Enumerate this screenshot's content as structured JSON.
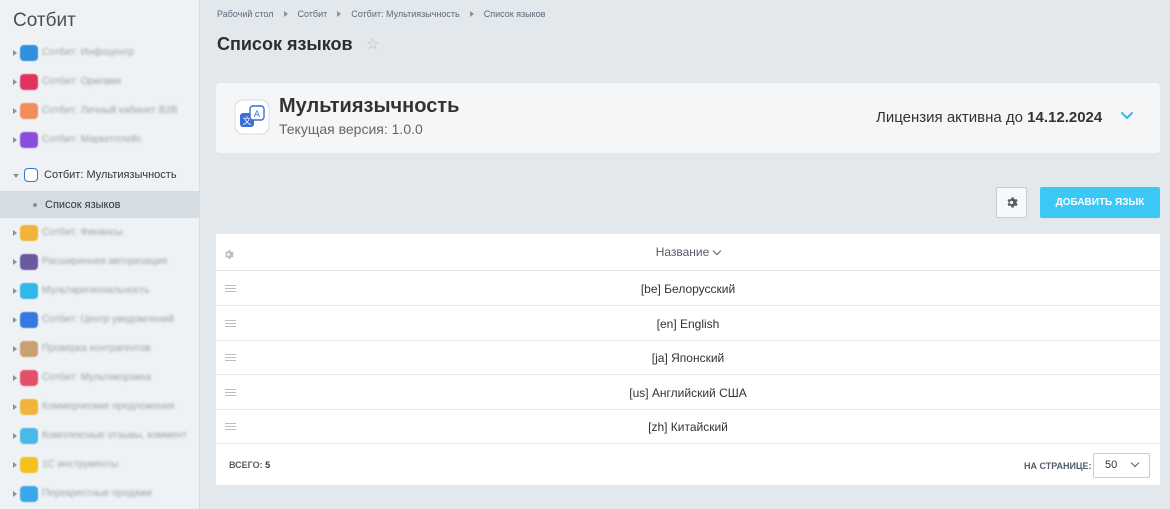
{
  "sidebar": {
    "title": "Сотбит",
    "items": [
      {
        "label": "Сотбит: Инфоцентр",
        "icon": "infocenter-icon",
        "color": "#2f8fe0"
      },
      {
        "label": "Сотбит: Оригами",
        "icon": "origami-icon",
        "color": "#e0345c"
      },
      {
        "label": "Сотбит: Личный кабинет B2B",
        "icon": "b2b-cabinet-icon",
        "color": "#f28c5a"
      },
      {
        "label": "Сотбит: Маркетплейс",
        "icon": "marketplace-icon",
        "color": "#8a4fd8"
      },
      {
        "label": "Сотбит: Мультиязычность",
        "icon": "translate-icon",
        "color": "#3a6fd8",
        "active": true
      },
      {
        "label": "Сотбит: Финансы",
        "icon": "finance-icon",
        "color": "#f0b43a"
      },
      {
        "label": "Расширенная авторизация",
        "icon": "auth-icon",
        "color": "#6a5a9e"
      },
      {
        "label": "Мультирегиональность",
        "icon": "multiregion-icon",
        "color": "#2fb8e8"
      },
      {
        "label": "Сотбит: Центр уведомлений",
        "icon": "notification-icon",
        "color": "#3478e0"
      },
      {
        "label": "Проверка контрагентов",
        "icon": "contractor-check-icon",
        "color": "#c9a070"
      },
      {
        "label": "Сотбит: Мультикорзина",
        "icon": "multicart-icon",
        "color": "#e4506a"
      },
      {
        "label": "Коммерческие предложения",
        "icon": "offers-icon",
        "color": "#f0b43a"
      },
      {
        "label": "Комплексные отзывы, коммент",
        "icon": "reviews-icon",
        "color": "#4ab8e8"
      },
      {
        "label": "1С инструменты",
        "icon": "1c-tools-icon",
        "color": "#f4c020"
      },
      {
        "label": "Перекрестные продажи",
        "icon": "cross-sales-icon",
        "color": "#3aa8e8"
      }
    ],
    "sub_item": "Список языков"
  },
  "breadcrumb": [
    "Рабочий стол",
    "Сотбит",
    "Сотбит: Мультиязычность",
    "Список языков"
  ],
  "page_title": "Список языков",
  "module": {
    "name": "Мультиязычность",
    "version": "Текущая версия: 1.0.0",
    "license_prefix": "Лицензия активна до",
    "license_date": "14.12.2024"
  },
  "toolbar": {
    "add_label": "ДОБАВИТЬ ЯЗЫК"
  },
  "grid": {
    "column_header": "Название",
    "rows": [
      "[be] Белорусский",
      "[en] English",
      "[ja] Японский",
      "[us] Английский США",
      "[zh] Китайский"
    ],
    "total_label": "ВСЕГО:",
    "total_value": "5",
    "per_page_label": "НА СТРАНИЦЕ:",
    "per_page_value": "50"
  },
  "colors": {
    "accent": "#3bc8f5",
    "background": "#e3e8ec"
  }
}
